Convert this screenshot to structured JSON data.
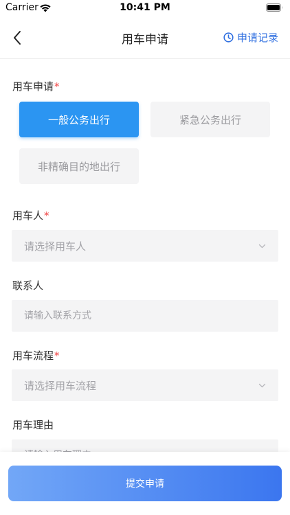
{
  "status_bar": {
    "carrier": "Carrier",
    "time": "10:41 PM",
    "wifi_icon": "wifi-icon",
    "battery_icon": "battery-icon"
  },
  "nav": {
    "title": "用车申请",
    "back_icon": "chevron-left-icon",
    "record_icon": "clock-icon",
    "record_label": "申请记录"
  },
  "form": {
    "type_section": {
      "label": "用车申请",
      "required_mark": "*",
      "options": [
        {
          "label": "一般公务出行",
          "selected": true
        },
        {
          "label": "紧急公务出行",
          "selected": false
        },
        {
          "label": "非精确目的地出行",
          "selected": false
        }
      ]
    },
    "user": {
      "label": "用车人",
      "required_mark": "*",
      "placeholder": "请选择用车人"
    },
    "contact": {
      "label": "联系人",
      "placeholder": "请输入联系方式"
    },
    "process": {
      "label": "用车流程",
      "required_mark": "*",
      "placeholder": "请选择用车流程"
    },
    "reason": {
      "label": "用车理由",
      "placeholder": "请输入用车理由"
    }
  },
  "submit": {
    "label": "提交申请"
  },
  "colors": {
    "accent": "#2b95f2",
    "link": "#2f6fe0",
    "required": "#f04848",
    "field_bg": "#f4f4f5",
    "submit_gradient_start": "#72a7f7",
    "submit_gradient_end": "#3b76ef"
  }
}
